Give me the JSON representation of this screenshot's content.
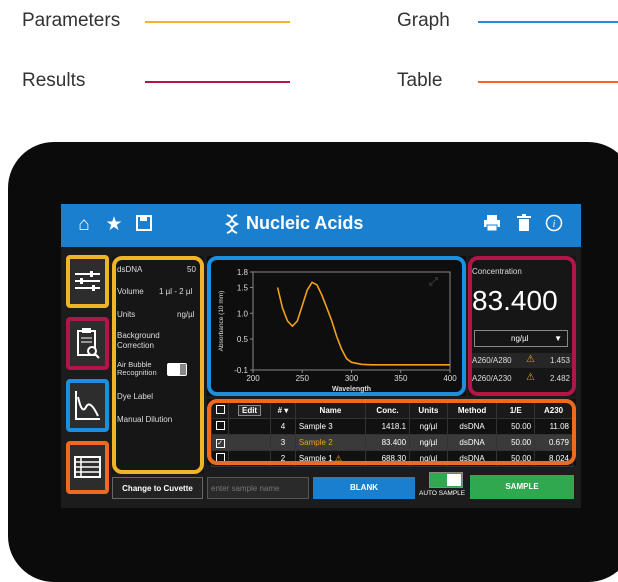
{
  "legend": {
    "parameters": {
      "label": "Parameters",
      "color": "#f0b429"
    },
    "graph": {
      "label": "Graph",
      "color": "#1b8fe0"
    },
    "results": {
      "label": "Results",
      "color": "#b0164a"
    },
    "table": {
      "label": "Table",
      "color": "#ee6a1f"
    }
  },
  "app": {
    "title": "Nucleic Acids"
  },
  "topbar_icons": [
    "home-icon",
    "star-icon",
    "save-icon",
    "print-icon",
    "trash-icon",
    "info-icon"
  ],
  "parameters": {
    "items": [
      {
        "label": "dsDNA",
        "value": "50"
      },
      {
        "label": "Volume",
        "value": "1 µl - 2 µl"
      },
      {
        "label": "Units",
        "value": "ng/µl"
      },
      {
        "label": "Background\nCorrection",
        "value": ""
      },
      {
        "label": "Air Bubble\nRecognition",
        "value": ""
      },
      {
        "label": "Dye Label",
        "value": ""
      },
      {
        "label": "Manual Dilution",
        "value": ""
      }
    ]
  },
  "chart_data": {
    "type": "line",
    "xlabel": "Wavelength",
    "ylabel": "Absorbance (10 mm)",
    "xlim": [
      200,
      400
    ],
    "ylim": [
      -0.1,
      1.8
    ],
    "xticks": [
      "200",
      "250",
      "300",
      "350",
      "400"
    ],
    "yticks": [
      "1.8",
      "1.5",
      "1.0",
      "0.5",
      "-0.1"
    ],
    "series": [
      {
        "color": "#f0a020",
        "x": [
          225,
          230,
          235,
          240,
          245,
          250,
          255,
          260,
          265,
          270,
          275,
          280,
          285,
          290,
          295,
          300,
          310,
          320,
          330,
          340,
          350,
          360,
          380,
          400
        ],
        "y": [
          1.5,
          1.1,
          0.85,
          0.75,
          0.85,
          1.15,
          1.45,
          1.6,
          1.55,
          1.35,
          1.1,
          0.85,
          0.55,
          0.3,
          0.12,
          0.05,
          0.01,
          0.0,
          0.0,
          0.0,
          0.0,
          0.0,
          0.0,
          0.0
        ]
      }
    ]
  },
  "results": {
    "concentration_label": "Concentration",
    "concentration_value": "83.400",
    "unit": "ng/µl",
    "ratios": [
      {
        "label": "A260/A280",
        "value": "1.453"
      },
      {
        "label": "A260/A230",
        "value": "2.482"
      }
    ]
  },
  "table": {
    "edit_label": "Edit",
    "headers": [
      "#",
      "Name",
      "Conc.",
      "Units",
      "Method",
      "1/E",
      "A230"
    ],
    "rows": [
      {
        "checked": false,
        "num": "4",
        "name": "Sample 3",
        "warn": false,
        "conc": "1418.1",
        "units": "ng/µl",
        "method": "dsDNA",
        "ie": "50.00",
        "a230": "11.08"
      },
      {
        "checked": true,
        "num": "3",
        "name": "Sample 2",
        "warn": false,
        "conc": "83.400",
        "units": "ng/µl",
        "method": "dsDNA",
        "ie": "50.00",
        "a230": "0.679"
      },
      {
        "checked": false,
        "num": "2",
        "name": "Sample 1",
        "warn": true,
        "conc": "688.30",
        "units": "ng/µl",
        "method": "dsDNA",
        "ie": "50.00",
        "a230": "8.024"
      }
    ]
  },
  "bottom": {
    "change_cuvette": "Change to Cuvette",
    "sample_name_placeholder": "enter sample name",
    "blank": "BLANK",
    "auto_sample": "AUTO SAMPLE",
    "sample": "SAMPLE"
  }
}
